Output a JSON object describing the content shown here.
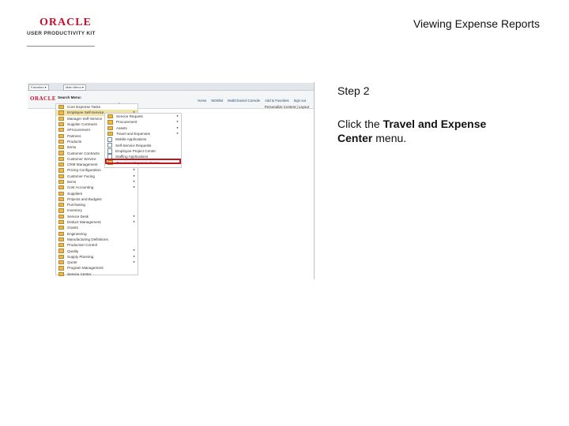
{
  "header": {
    "logo_word": "ORACLE",
    "logo_sub": "USER PRODUCTIVITY KIT",
    "title": "Viewing Expense Reports"
  },
  "step": {
    "label": "Step 2",
    "instruction_prefix": "Click the ",
    "instruction_target": "Travel and Expense Center",
    "instruction_suffix": " menu."
  },
  "screenshot": {
    "tabs": [
      "Favorites ▾",
      "Main Menu ▾"
    ],
    "logo": "ORACLE",
    "search_label": "Search Menu:",
    "nav_links": [
      "Home",
      "Worklist",
      "MultiChannel Console",
      "Add to Favorites",
      "Sign out"
    ],
    "personalize": "Personalize Content | Layout",
    "left_menu": [
      "Core Expense Tasks",
      "Employee Self-Service",
      "Manager Self-Service",
      "Supplier Contracts",
      "eProcurement",
      "Partners",
      "Products",
      "Items",
      "Customer Contracts",
      "Customer Service",
      "CRM Management",
      "Pricing Configuration",
      "Customer Facing",
      "Items",
      "Cost Accounting",
      "Suppliers",
      "Projects and Budgets",
      "Purchasing",
      "Inventory",
      "Service Desk",
      "Deduct Management",
      "Grants",
      "Engineering",
      "Manufacturing Definitions",
      "Production Control",
      "Quality",
      "Supply Planning",
      "Quote",
      "Program Management",
      "Service Center"
    ],
    "left_menu_arrows": [
      1,
      2,
      3,
      4,
      5,
      6,
      7,
      8,
      9,
      10,
      11,
      12,
      13,
      14,
      19,
      20,
      25,
      26,
      27
    ],
    "submenu": [
      {
        "label": "Service Request",
        "icon": "folder",
        "arrow": true
      },
      {
        "label": "Procurement",
        "icon": "folder",
        "arrow": true
      },
      {
        "label": "Assets",
        "icon": "folder",
        "arrow": true
      },
      {
        "label": "Travel and Expenses",
        "icon": "folder",
        "arrow": true
      },
      {
        "label": "Mobile Applications",
        "icon": "doc",
        "arrow": false
      },
      {
        "label": "Self-Service Requests",
        "icon": "doc",
        "arrow": false
      },
      {
        "label": "Employee Project Center",
        "icon": "doc",
        "arrow": false
      },
      {
        "label": "Staffing Applications",
        "icon": "doc",
        "arrow": false
      },
      {
        "label": "Travel and Expense Center",
        "icon": "folder",
        "arrow": false,
        "highlighted": true
      }
    ]
  }
}
